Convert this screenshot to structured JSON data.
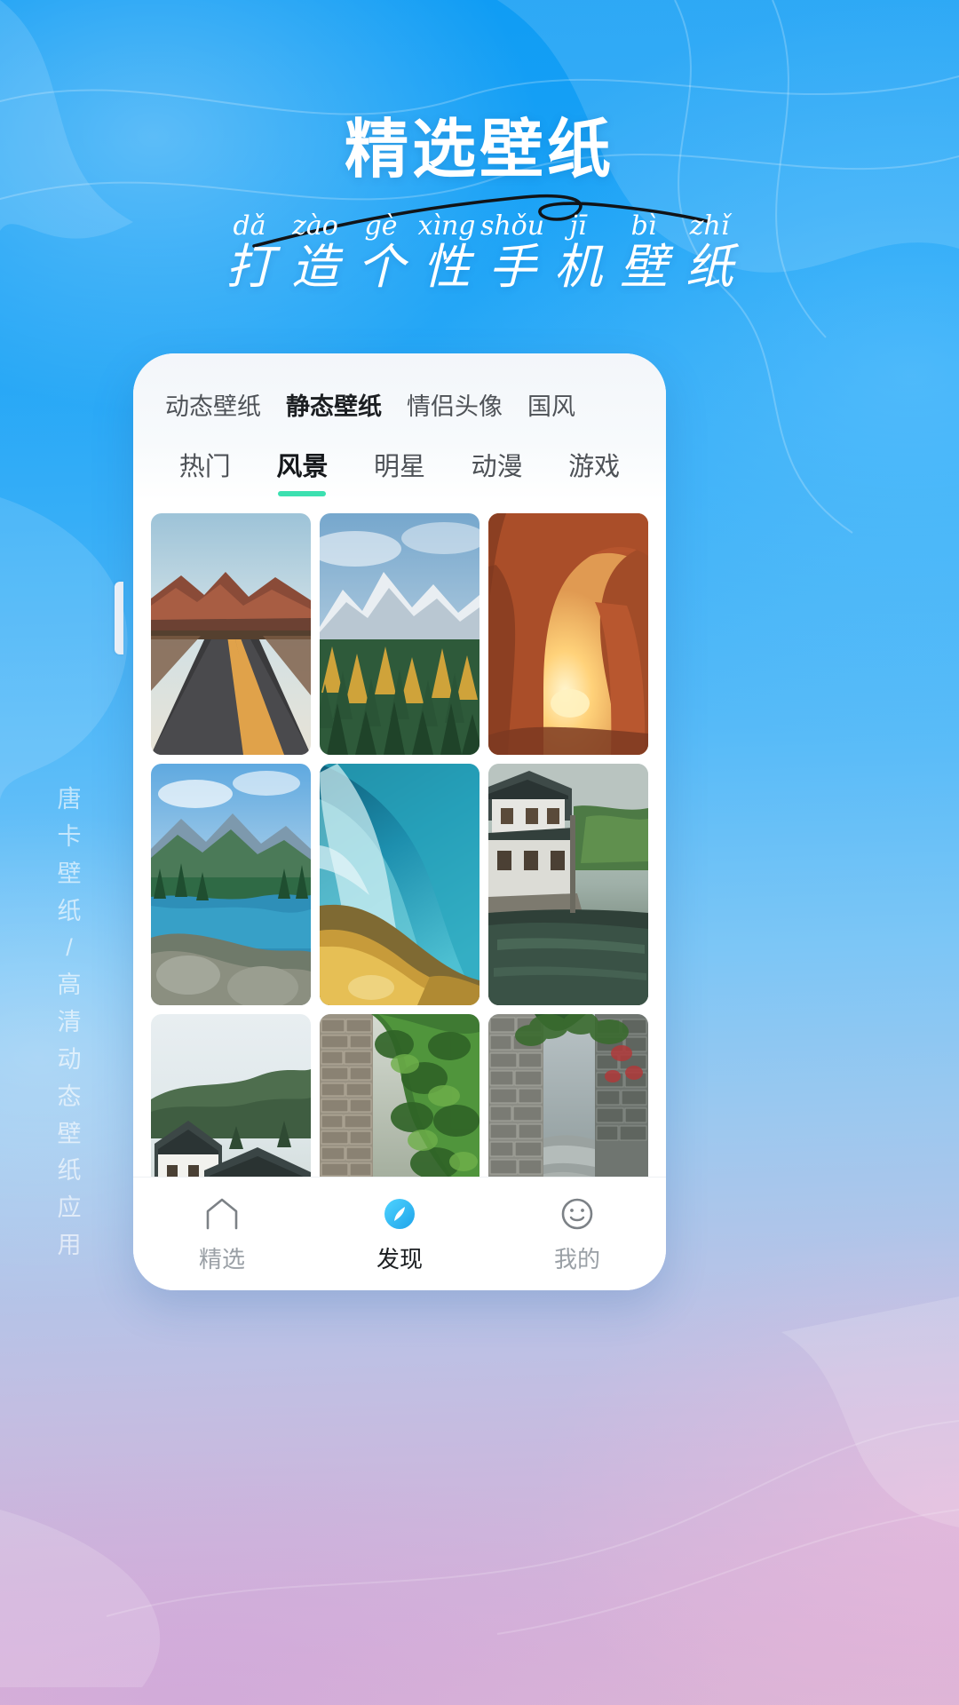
{
  "header": {
    "title": "精选壁纸",
    "pinyin": [
      "dǎ",
      "zào",
      "gè",
      "xìng",
      "shǒu",
      "jī",
      "bì",
      "zhǐ"
    ],
    "subtitle_chars": [
      "打",
      "造",
      "个",
      "性",
      "手",
      "机",
      "壁",
      "纸"
    ]
  },
  "side_text": [
    "唐",
    "卡",
    "壁",
    "纸",
    "/",
    "高",
    "清",
    "动",
    "态",
    "壁",
    "纸",
    "应",
    "用"
  ],
  "colors": {
    "bg_top": "#0f9cf4",
    "bg_bottom": "#dbb4d6",
    "accent_teal": "#3ce0b0",
    "accent_blue": "#29b6f0",
    "tab_active_text": "#15181b",
    "tab_text": "#4e5257",
    "nav_inactive": "#9aa0a6"
  },
  "phone": {
    "category_tabs": [
      {
        "label": "动态壁纸",
        "active": false
      },
      {
        "label": "静态壁纸",
        "active": true
      },
      {
        "label": "情侣头像",
        "active": false
      },
      {
        "label": "国风",
        "active": false
      }
    ],
    "sub_tabs": [
      {
        "label": "热门",
        "active": false
      },
      {
        "label": "风景",
        "active": true
      },
      {
        "label": "明星",
        "active": false
      },
      {
        "label": "动漫",
        "active": false
      },
      {
        "label": "游戏",
        "active": false
      }
    ],
    "gallery": [
      {
        "name": "desert-highway-wallpaper"
      },
      {
        "name": "snowy-mountain-forest-wallpaper"
      },
      {
        "name": "red-rock-arch-sunset-wallpaper"
      },
      {
        "name": "alpine-lake-wallpaper"
      },
      {
        "name": "turquoise-rapids-wallpaper"
      },
      {
        "name": "jiangnan-water-town-wallpaper"
      },
      {
        "name": "hui-style-village-wallpaper"
      },
      {
        "name": "stone-wall-greenery-wallpaper"
      },
      {
        "name": "stone-alley-wallpaper"
      }
    ],
    "bottom_nav": [
      {
        "label": "精选",
        "icon": "home-icon",
        "active": false
      },
      {
        "label": "发现",
        "icon": "compass-icon",
        "active": true
      },
      {
        "label": "我的",
        "icon": "smiley-icon",
        "active": false
      }
    ]
  }
}
